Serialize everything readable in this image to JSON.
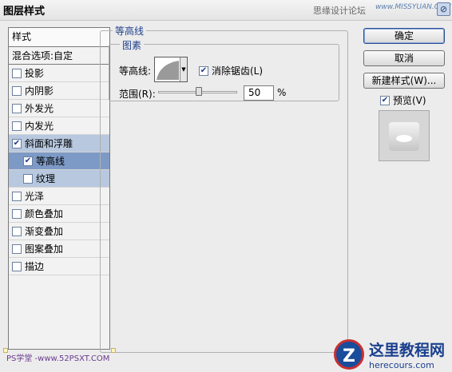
{
  "window": {
    "title": "图层样式",
    "watermark_top": "思缘设计论坛",
    "watermark_logo": "www.MISSYUAN.COM",
    "close_glyph": "⊘"
  },
  "left_panel": {
    "header": "样式",
    "blend_options": "混合选项:自定",
    "items": [
      {
        "label": "投影",
        "checked": false
      },
      {
        "label": "内阴影",
        "checked": false
      },
      {
        "label": "外发光",
        "checked": false
      },
      {
        "label": "内发光",
        "checked": false
      },
      {
        "label": "斜面和浮雕",
        "checked": true
      },
      {
        "label": "等高线",
        "checked": true
      },
      {
        "label": "纹理",
        "checked": false
      },
      {
        "label": "光泽",
        "checked": false
      },
      {
        "label": "颜色叠加",
        "checked": false
      },
      {
        "label": "渐变叠加",
        "checked": false
      },
      {
        "label": "图案叠加",
        "checked": false
      },
      {
        "label": "描边",
        "checked": false
      }
    ]
  },
  "main": {
    "group_title": "等高线",
    "subgroup_title": "图素",
    "contour_label": "等高线:",
    "antialias_label": "消除锯齿(L)",
    "antialias_checked": true,
    "range_label": "范围(R):",
    "range_value": "50",
    "range_unit": "%",
    "range_fraction": 0.5
  },
  "buttons": {
    "ok": "确定",
    "cancel": "取消",
    "new_style": "新建样式(W)...",
    "preview_label": "预览(V)",
    "preview_checked": true
  },
  "watermarks": {
    "bottom_left": "PS学堂 -www.52PSXT.COM",
    "site_logo": "Z",
    "site_title": "这里教程网",
    "site_url": "herecours.com"
  },
  "colors": {
    "selected_bg": "#7d9ac6",
    "selected_parent_bg": "#b7c8df",
    "group_title": "#1e3f8c"
  }
}
